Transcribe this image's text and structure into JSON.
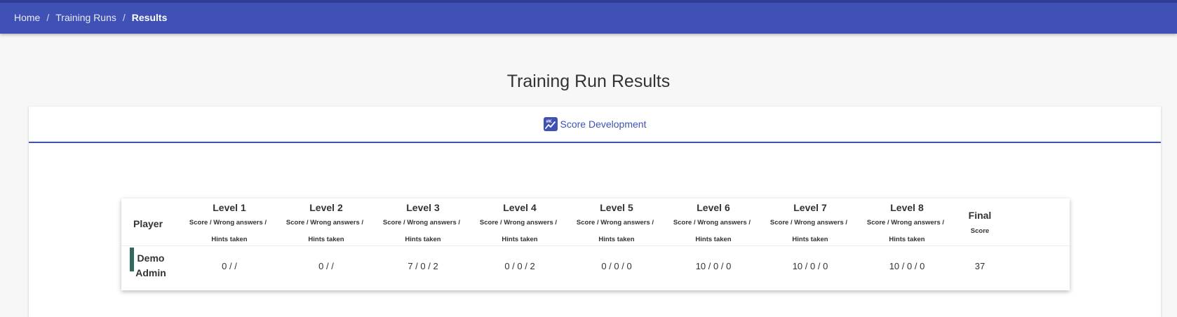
{
  "breadcrumb": {
    "items": [
      "Home",
      "Training Runs",
      "Results"
    ],
    "separator": "/"
  },
  "page": {
    "title": "Training Run Results"
  },
  "tabs": [
    {
      "label": "Score Development",
      "icon": "score-chart-icon",
      "active": true
    }
  ],
  "colors": {
    "primary": "#3f51b5",
    "player_marker": "#2e6b5c"
  },
  "table": {
    "player_header": "Player",
    "levels": [
      {
        "title": "Level 1",
        "sub": "Score   /  Wrong answers   /",
        "hints": "Hints taken"
      },
      {
        "title": "Level 2",
        "sub": "Score   /  Wrong answers   /",
        "hints": "Hints taken"
      },
      {
        "title": "Level 3",
        "sub": "Score   /  Wrong answers   /",
        "hints": "Hints taken"
      },
      {
        "title": "Level 4",
        "sub": "Score   /  Wrong answers   /",
        "hints": "Hints taken"
      },
      {
        "title": "Level 5",
        "sub": "Score   /  Wrong answers   /",
        "hints": "Hints taken"
      },
      {
        "title": "Level 6",
        "sub": "Score   /  Wrong answers   /",
        "hints": "Hints taken"
      },
      {
        "title": "Level 7",
        "sub": "Score   /  Wrong answers   /",
        "hints": "Hints taken"
      },
      {
        "title": "Level 8",
        "sub": "Score   /  Wrong answers   /",
        "hints": "Hints taken"
      }
    ],
    "final_header": "Final",
    "final_sub": "Score",
    "rows": [
      {
        "player": "Demo Admin",
        "levels": [
          "0 / /",
          "0 / /",
          "7 / 0 / 2",
          "0 / 0 / 2",
          "0 / 0 / 0",
          "10 / 0 / 0",
          "10 / 0 / 0",
          "10 / 0 / 0"
        ],
        "final": "37"
      }
    ]
  }
}
